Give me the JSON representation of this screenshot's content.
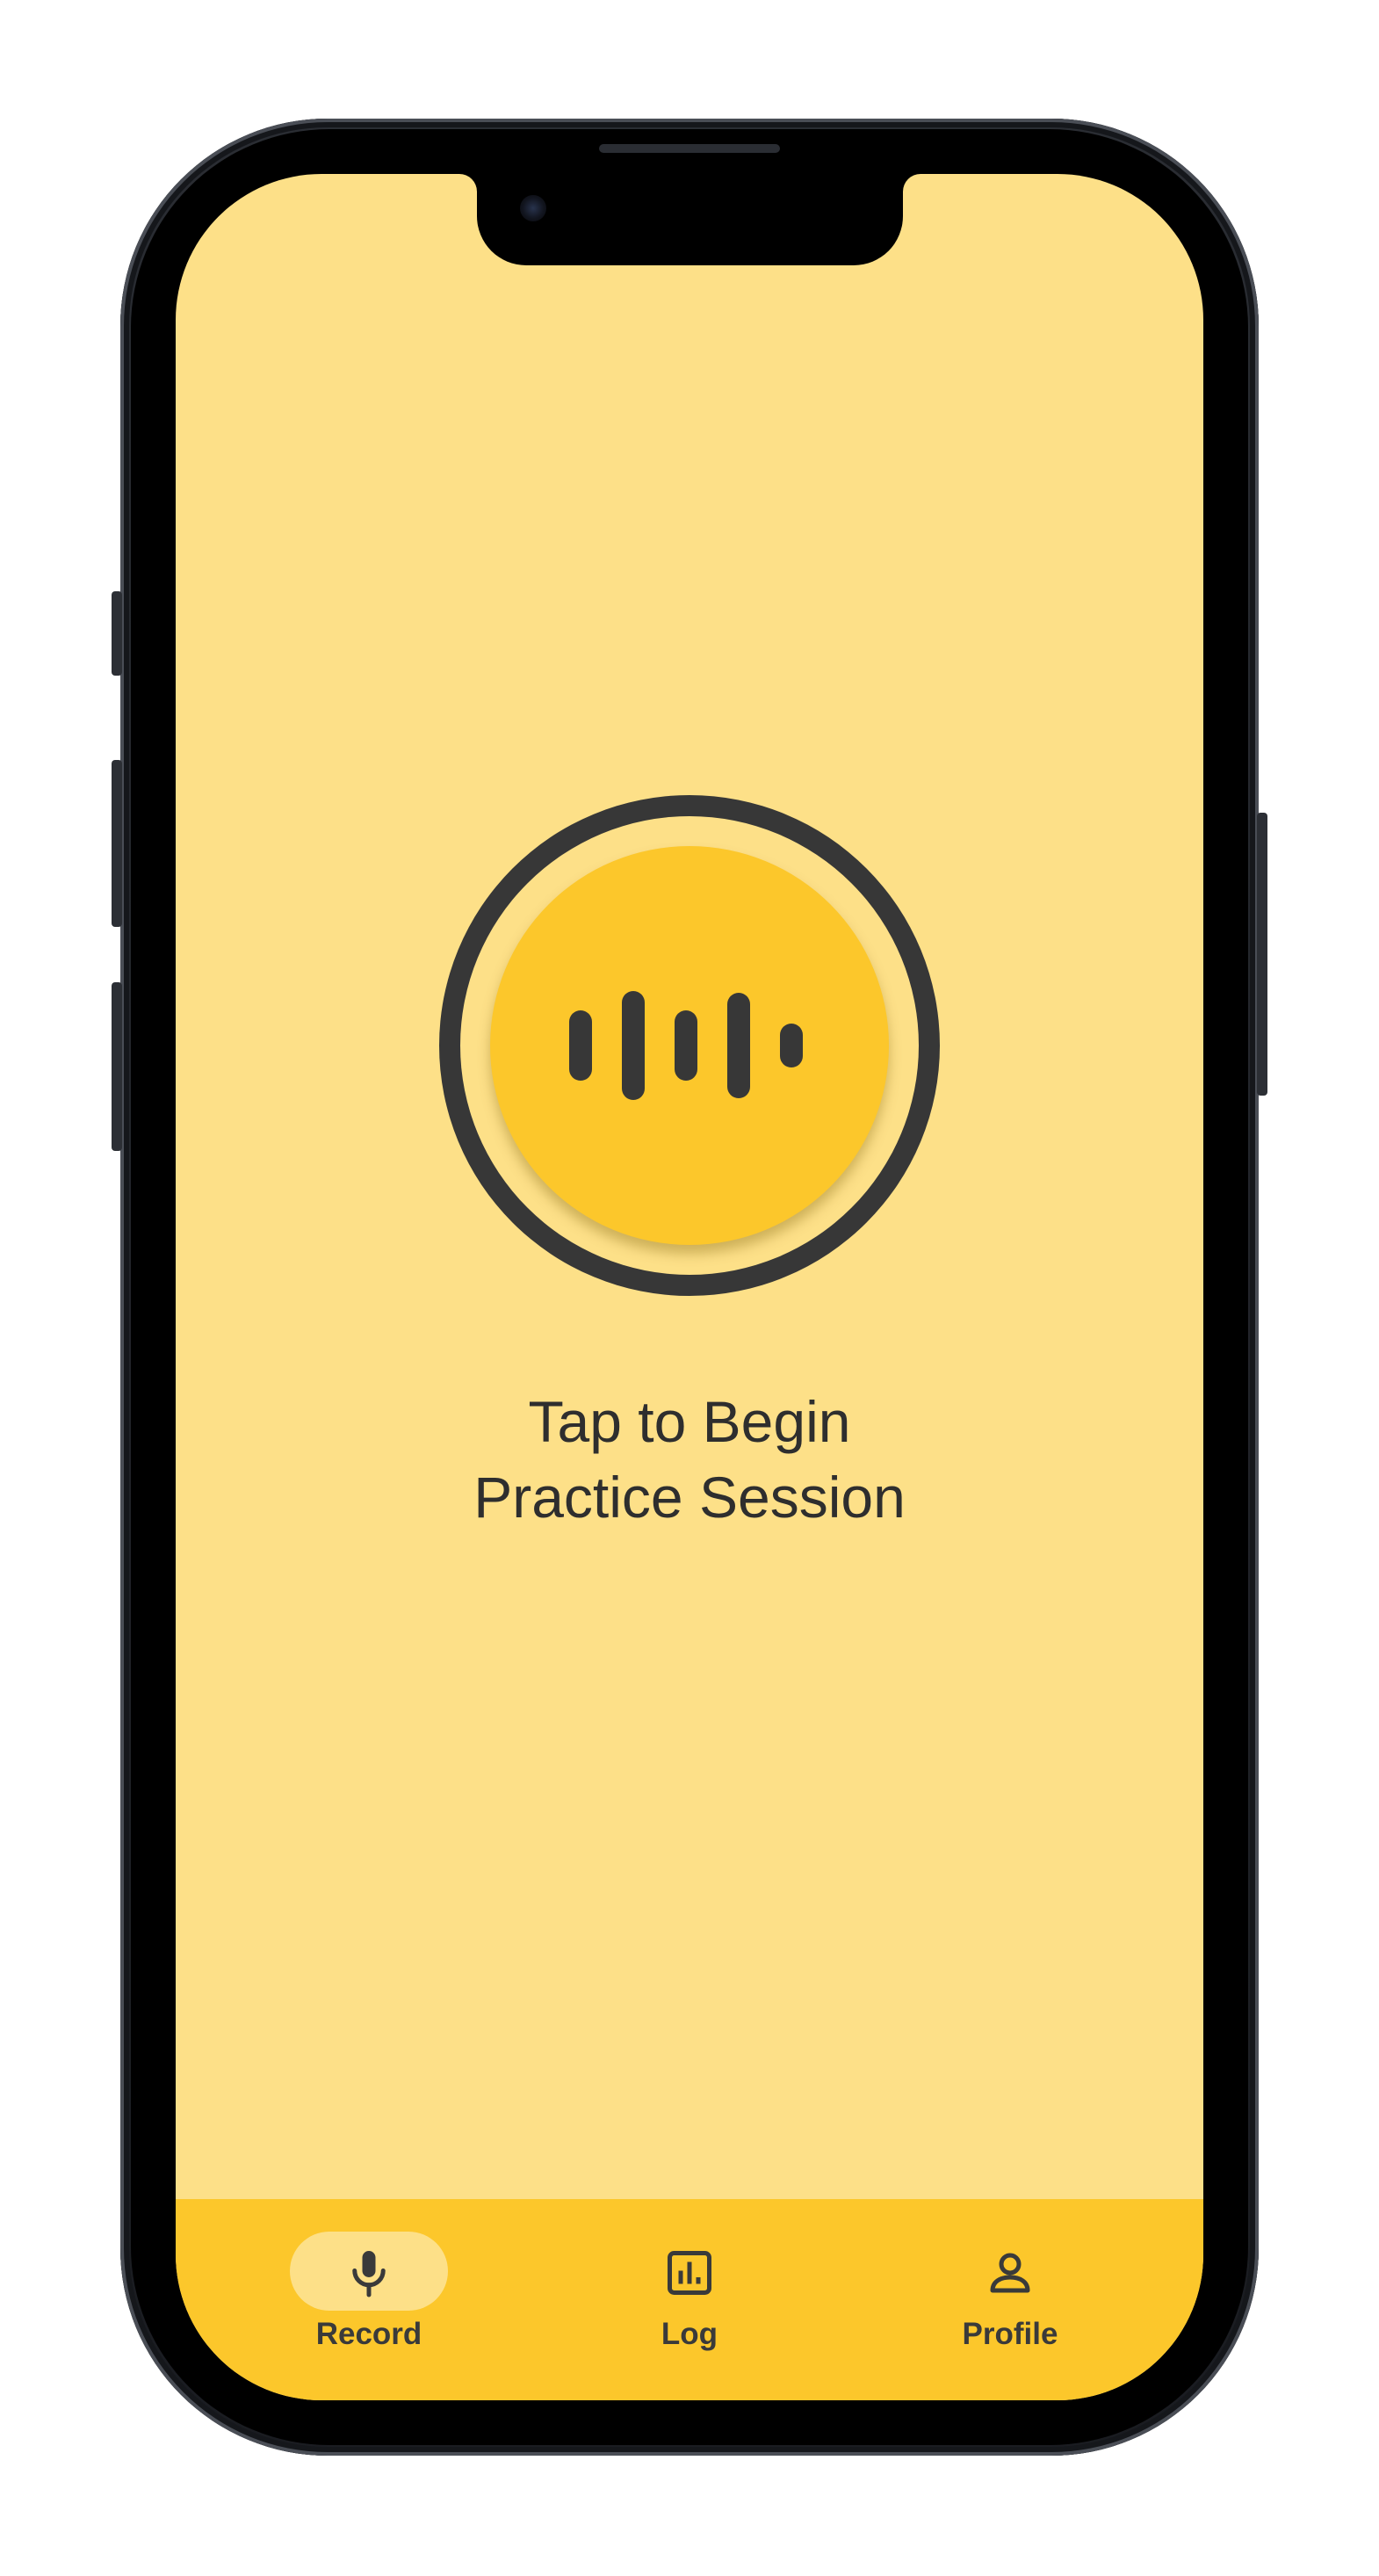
{
  "app": {
    "prompt_line1": "Tap to Begin",
    "prompt_line2": "Practice Session"
  },
  "record_button": {
    "icon": "audio-waveform-icon"
  },
  "nav": {
    "items": [
      {
        "label": "Record",
        "icon": "microphone-icon",
        "active": true
      },
      {
        "label": "Log",
        "icon": "bar-chart-icon",
        "active": false
      },
      {
        "label": "Profile",
        "icon": "person-icon",
        "active": false
      }
    ]
  },
  "colors": {
    "background": "#fde088",
    "accent": "#fcc72b",
    "dark": "#373737",
    "text": "#2e2e2e"
  }
}
